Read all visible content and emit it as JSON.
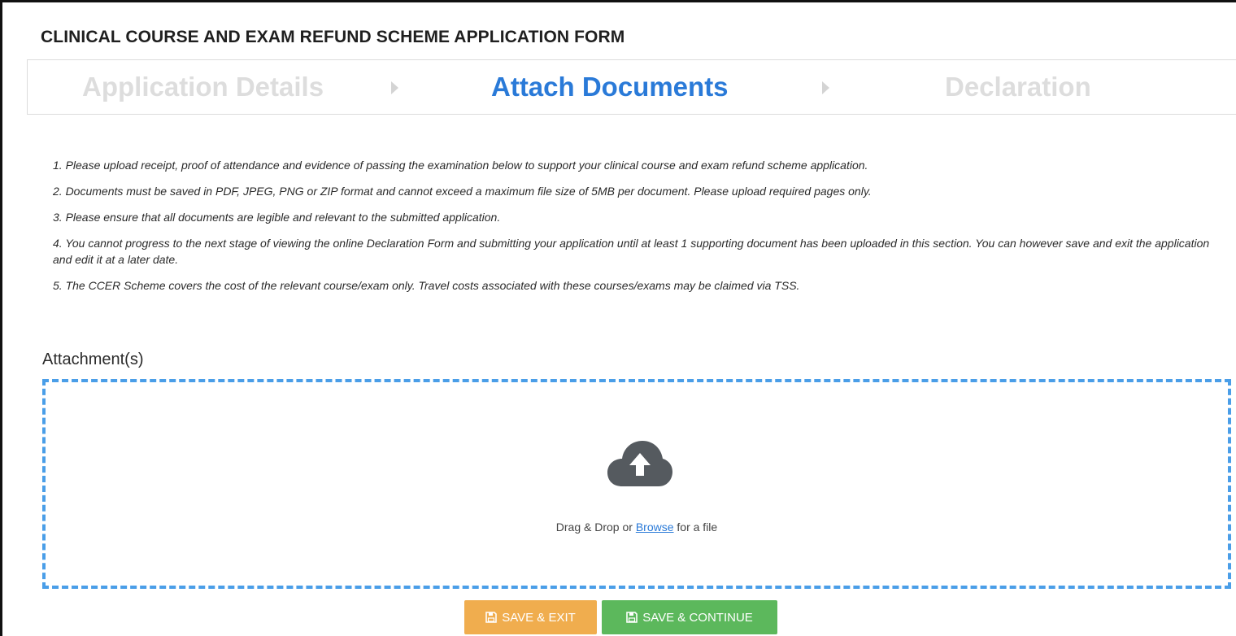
{
  "form": {
    "title": "CLINICAL COURSE AND EXAM REFUND SCHEME APPLICATION FORM"
  },
  "steps": [
    {
      "label": "Application Details",
      "state": "inactive"
    },
    {
      "label": "Attach Documents",
      "state": "active"
    },
    {
      "label": "Declaration",
      "state": "inactive"
    }
  ],
  "instructions": [
    "1. Please upload receipt, proof of attendance and evidence of passing the examination below to support your clinical course and exam refund scheme application.",
    "2. Documents must be saved in PDF, JPEG, PNG or ZIP format and cannot exceed a maximum file size of 5MB per document. Please upload required pages only.",
    "3. Please ensure that all documents are legible and relevant to the submitted application.",
    "4. You cannot progress to the next stage of viewing the online Declaration Form and submitting your application until at least 1 supporting document has been uploaded in this section. You can however save and exit the application and edit it at a later date.",
    "5. The CCER Scheme covers the cost of the relevant course/exam only. Travel costs associated with these courses/exams may be claimed via TSS."
  ],
  "attachments": {
    "label": "Attachment(s)",
    "drop_text_before": "Drag & Drop or ",
    "browse_link": "Browse",
    "drop_text_after": " for a file",
    "icon": "cloud-upload-icon"
  },
  "buttons": {
    "save_exit": "SAVE & EXIT",
    "save_continue": "SAVE & CONTINUE",
    "icon": "floppy-disk-icon"
  },
  "colors": {
    "active_step": "#2a7ad8",
    "inactive_step": "#dddddd",
    "dropzone_border": "#4a9ee8",
    "save_exit": "#f0ad4e",
    "save_continue": "#5cb85c"
  }
}
